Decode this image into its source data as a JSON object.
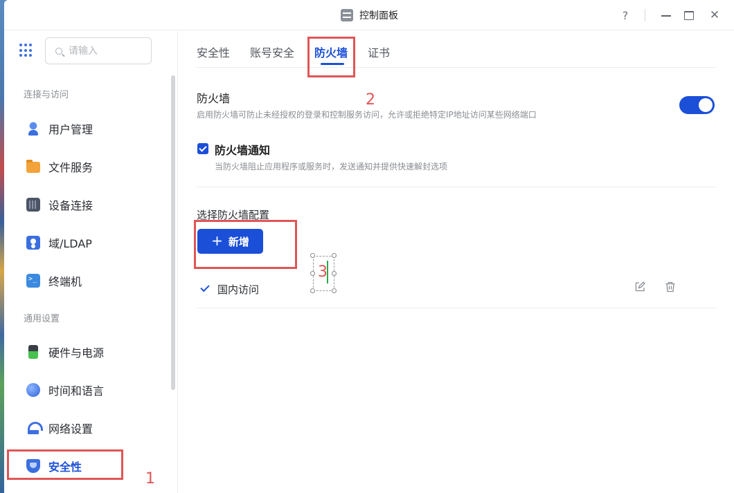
{
  "window": {
    "title": "控制面板",
    "help": "?",
    "minimize": "",
    "maximize": "",
    "close": "✕"
  },
  "sidebar": {
    "search_placeholder": "请输入",
    "sections": [
      {
        "label": "连接与访问",
        "items": [
          {
            "label": "用户管理",
            "icon": "user-icon"
          },
          {
            "label": "文件服务",
            "icon": "folder-icon"
          },
          {
            "label": "设备连接",
            "icon": "device-icon"
          },
          {
            "label": "域/LDAP",
            "icon": "ldap-icon"
          },
          {
            "label": "终端机",
            "icon": "terminal-icon"
          }
        ]
      },
      {
        "label": "通用设置",
        "items": [
          {
            "label": "硬件与电源",
            "icon": "battery-icon"
          },
          {
            "label": "时间和语言",
            "icon": "globe-icon"
          },
          {
            "label": "网络设置",
            "icon": "network-icon"
          },
          {
            "label": "安全性",
            "icon": "shield-icon",
            "active": true
          }
        ]
      }
    ]
  },
  "tabs": [
    {
      "label": "安全性"
    },
    {
      "label": "账号安全"
    },
    {
      "label": "防火墙",
      "active": true
    },
    {
      "label": "证书"
    }
  ],
  "firewall": {
    "title": "防火墙",
    "description": "启用防火墙可防止未经授权的登录和控制服务访问，允许或拒绝特定IP地址访问某些网络端口",
    "enabled": true
  },
  "notify": {
    "checked": true,
    "title": "防火墙通知",
    "description": "当防火墙阻止应用程序或服务时，发送通知并提供快速解封选项"
  },
  "config": {
    "label": "选择防火墙配置",
    "add_button": "新增",
    "add_icon": "+",
    "profiles": [
      {
        "label": "国内访问",
        "selected": true
      }
    ]
  },
  "annotations": {
    "n1": "1",
    "n2": "2",
    "n3": "3",
    "color": "#e05555"
  },
  "colors": {
    "accent": "#1b4fd8",
    "text": "#2a2d33",
    "muted": "#8a8d93"
  }
}
